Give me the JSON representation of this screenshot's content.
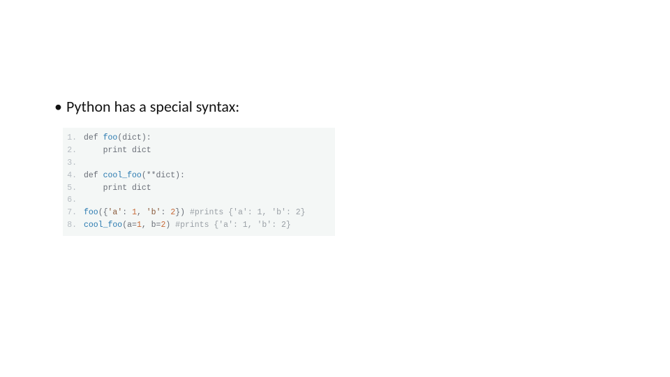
{
  "bullet": "Python has a special syntax:",
  "code": {
    "lines": [
      {
        "n": "1.",
        "tokens": [
          {
            "cls": "kw",
            "t": "def "
          },
          {
            "cls": "fn",
            "t": "foo"
          },
          {
            "cls": "",
            "t": "(dict):"
          }
        ]
      },
      {
        "n": "2.",
        "tokens": [
          {
            "cls": "",
            "t": "    "
          },
          {
            "cls": "kw",
            "t": "print"
          },
          {
            "cls": "",
            "t": " dict"
          }
        ]
      },
      {
        "n": "3.",
        "tokens": [
          {
            "cls": "",
            "t": ""
          }
        ]
      },
      {
        "n": "4.",
        "tokens": [
          {
            "cls": "kw",
            "t": "def "
          },
          {
            "cls": "fn",
            "t": "cool_foo"
          },
          {
            "cls": "",
            "t": "(**dict):"
          }
        ]
      },
      {
        "n": "5.",
        "tokens": [
          {
            "cls": "",
            "t": "    "
          },
          {
            "cls": "kw",
            "t": "print"
          },
          {
            "cls": "",
            "t": " dict"
          }
        ]
      },
      {
        "n": "6.",
        "tokens": [
          {
            "cls": "",
            "t": ""
          }
        ]
      },
      {
        "n": "7.",
        "tokens": [
          {
            "cls": "fn",
            "t": "foo"
          },
          {
            "cls": "",
            "t": "({"
          },
          {
            "cls": "str",
            "t": "'a'"
          },
          {
            "cls": "",
            "t": ": "
          },
          {
            "cls": "num",
            "t": "1"
          },
          {
            "cls": "",
            "t": ", "
          },
          {
            "cls": "str",
            "t": "'b'"
          },
          {
            "cls": "",
            "t": ": "
          },
          {
            "cls": "num",
            "t": "2"
          },
          {
            "cls": "",
            "t": "}) "
          },
          {
            "cls": "cmt",
            "t": "#prints {'a': 1, 'b': 2}"
          }
        ]
      },
      {
        "n": "8.",
        "tokens": [
          {
            "cls": "fn",
            "t": "cool_foo"
          },
          {
            "cls": "",
            "t": "(a="
          },
          {
            "cls": "num",
            "t": "1"
          },
          {
            "cls": "",
            "t": ", b="
          },
          {
            "cls": "num",
            "t": "2"
          },
          {
            "cls": "",
            "t": ") "
          },
          {
            "cls": "cmt",
            "t": "#prints {'a': 1, 'b': 2}"
          }
        ]
      }
    ]
  }
}
